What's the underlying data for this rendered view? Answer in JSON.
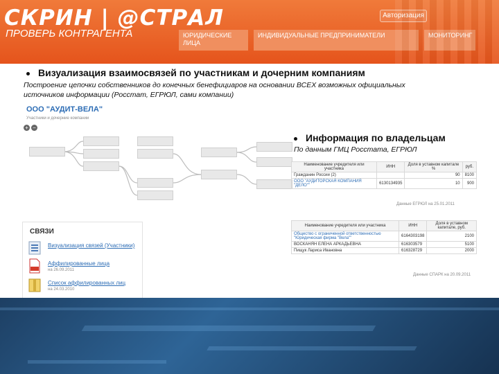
{
  "header": {
    "logo": "СКРИН | @СТРАЛ",
    "tagline": "ПРОВЕРЬ КОНТРАГЕНТА",
    "login_label": "Авторизация",
    "nav": [
      {
        "label": "ЮРИДИЧЕСКИЕ ЛИЦА"
      },
      {
        "label": "ИНДИВИДУАЛЬНЫЕ ПРЕДПРИНИМАТЕЛИ"
      },
      {
        "label": "МОНИТОРИНГ"
      }
    ]
  },
  "section1": {
    "title": "Визуализация взаимосвязей по участникам и дочерним компаниям",
    "description": "Построение цепочки собственников до конечных бенефициаров на основании ВСЕХ возможных официальных источников информации (Росстат, ЕГРЮЛ, сами компании)"
  },
  "tree": {
    "company_name": "ООО \"АУДИТ-ВЕЛА\"",
    "subtitle": "Участники и дочерние компании"
  },
  "section2": {
    "title": "Информация по владельцам",
    "description": "По данным ГМЦ Росстата, ЕГРЮЛ"
  },
  "table1": {
    "headers": [
      "Наименование учредителя или участника",
      "ИНН",
      "Доля в уставном капитале %",
      "руб."
    ],
    "rows": [
      [
        "Гражданин России (2)",
        "",
        "90",
        "8100"
      ],
      [
        "ООО \"АУДИТОРСКАЯ КОМПАНИЯ \"ДЕЛО\"\"",
        "6130134935",
        "10",
        "900"
      ]
    ],
    "note": "Данные ЕГРЮЛ на 25.01.2011"
  },
  "table2": {
    "headers": [
      "Наименование учредителя или участника",
      "ИНН",
      "Доля в уставном капитале, руб."
    ],
    "rows": [
      [
        "Общество с ограниченной ответственностью \"Юридическая фирма \"Вела\"\"",
        "6164303198",
        "2100"
      ],
      [
        "ВОСКАНЯН ЕЛЕНА АРКАДЬЕВНА",
        "616303579",
        "5100"
      ],
      [
        "Пищук Лариса Ивановна",
        "616328729",
        "2000"
      ]
    ],
    "note": "Данные СПАРК на 20.09.2011"
  },
  "svyazi": {
    "title": "СВЯЗИ",
    "items": [
      {
        "label": "Визуализация связей (Участники)",
        "sub": ""
      },
      {
        "label": "Аффилированные лица",
        "sub": "на 26.09.2011"
      },
      {
        "label": "Список аффилированных лиц",
        "sub": "на 24.03.2010"
      }
    ]
  }
}
